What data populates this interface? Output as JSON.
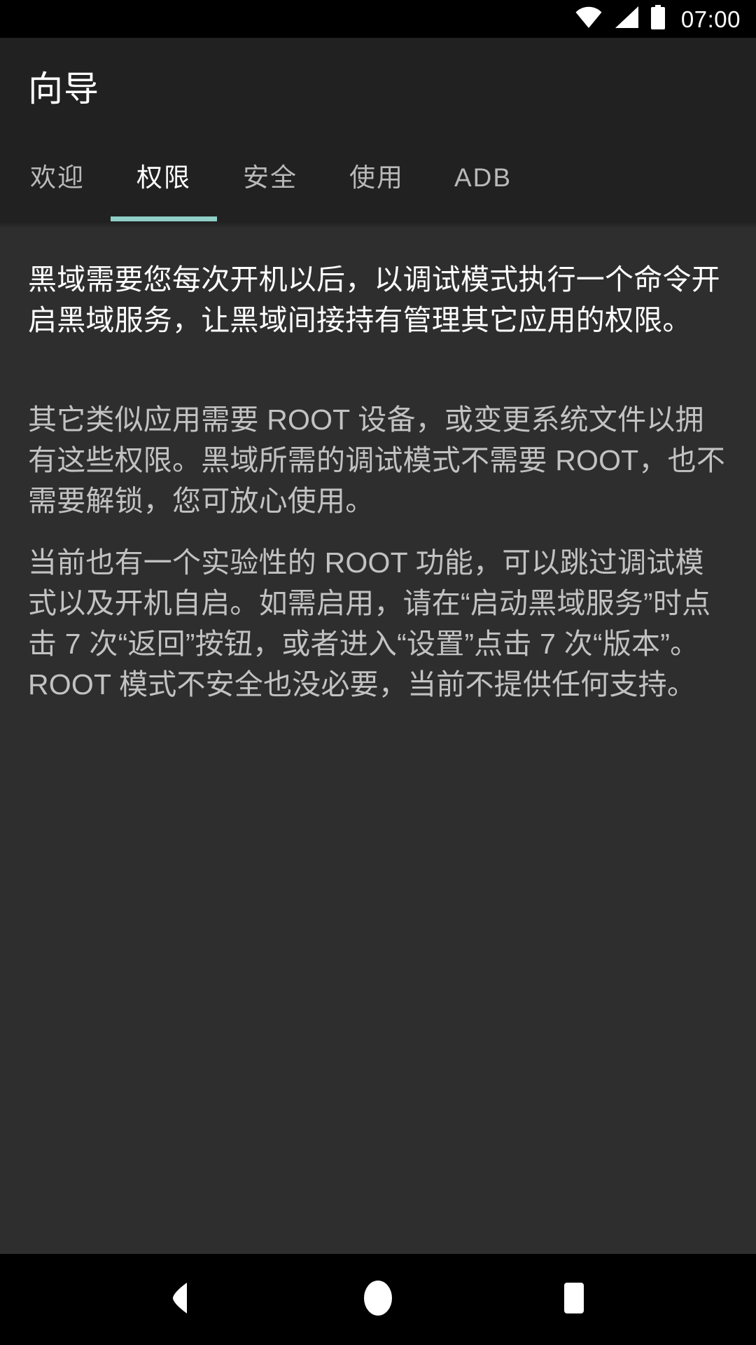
{
  "status_bar": {
    "icons": [
      "wifi-icon",
      "signal-icon",
      "battery-icon"
    ],
    "time": "07:00"
  },
  "app_bar": {
    "title": "向导"
  },
  "tabs": {
    "active_index": 1,
    "indicator_color": "#8fcfc8",
    "items": [
      {
        "label": "欢迎"
      },
      {
        "label": "权限"
      },
      {
        "label": "安全"
      },
      {
        "label": "使用"
      },
      {
        "label": "ADB"
      }
    ]
  },
  "content": {
    "paragraphs": [
      {
        "text": "黑域需要您每次开机以后，以调试模式执行一个命令开启黑域服务，让黑域间接持有管理其它应用的权限。",
        "emphasis": "primary"
      },
      {
        "text": "其它类似应用需要 ROOT 设备，或变更系统文件以拥有这些权限。黑域所需的调试模式不需要 ROOT，也不需要解锁，您可放心使用。",
        "emphasis": "secondary"
      },
      {
        "text": "当前也有一个实验性的 ROOT 功能，可以跳过调试模式以及开机自启。如需启用，请在“启动黑域服务”时点击 7 次“返回”按钮，或者进入“设置”点击 7 次“版本”。ROOT 模式不安全也没必要，当前不提供任何支持。",
        "emphasis": "secondary"
      }
    ]
  },
  "nav_bar": {
    "buttons": [
      {
        "name": "back-icon"
      },
      {
        "name": "home-icon"
      },
      {
        "name": "recents-icon"
      }
    ]
  }
}
